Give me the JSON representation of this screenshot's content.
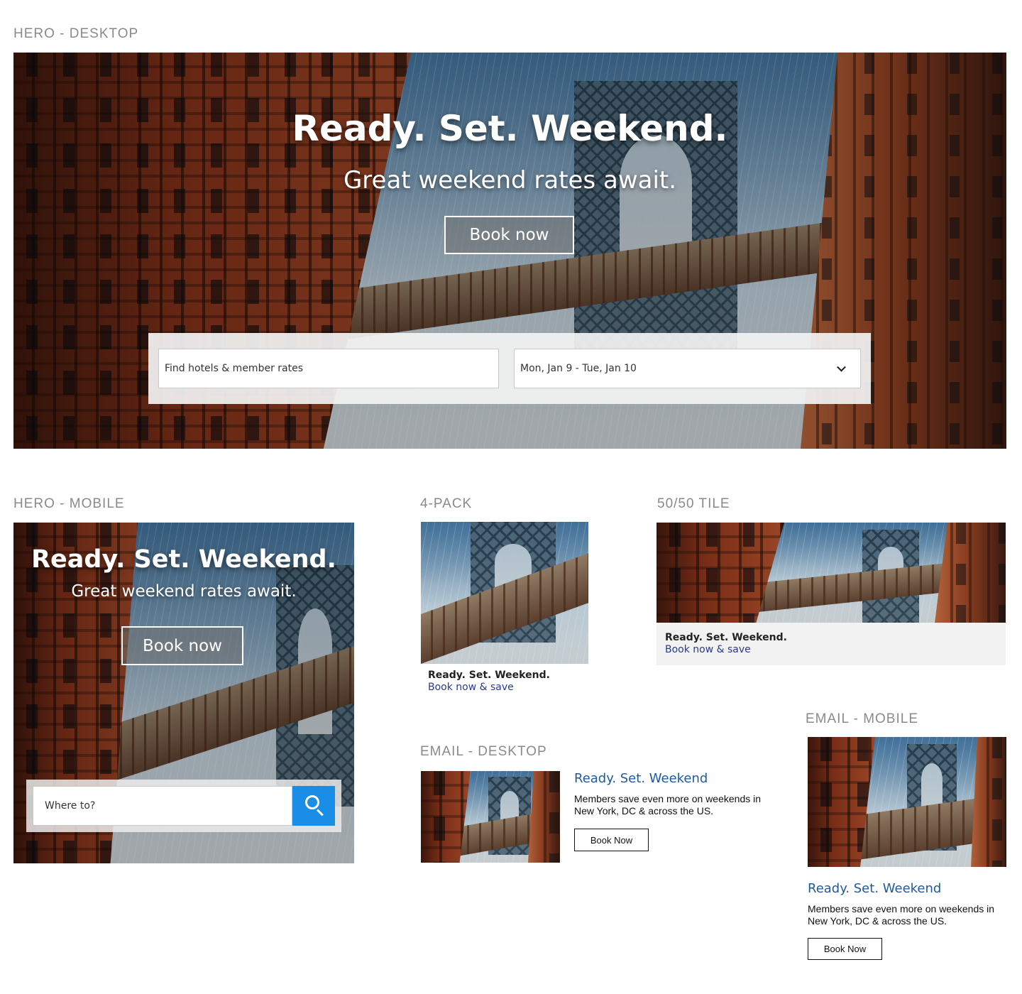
{
  "labels": {
    "hero_desktop": "HERO - DESKTOP",
    "hero_mobile": "HERO - MOBILE",
    "four_pack": "4-PACK",
    "fifty_tile": "50/50 TILE",
    "email_desktop": "EMAIL - DESKTOP",
    "email_mobile": "EMAIL - MOBILE"
  },
  "hero_desktop": {
    "title": "Ready. Set. Weekend.",
    "subtitle": "Great weekend rates await.",
    "cta": "Book now",
    "search_placeholder": "Find hotels & member rates",
    "dates": "Mon, Jan 9 - Tue, Jan 10"
  },
  "hero_mobile": {
    "title": "Ready. Set. Weekend.",
    "subtitle": "Great weekend rates await.",
    "cta": "Book now",
    "search_placeholder": "Where to?"
  },
  "four_pack": {
    "title": "Ready. Set. Weekend.",
    "link": "Book now & save"
  },
  "fifty_tile": {
    "title": "Ready. Set. Weekend.",
    "link": "Book now & save"
  },
  "email_desktop": {
    "title": "Ready. Set. Weekend",
    "copy": "Members save even more on weekends in New York, DC & across the US.",
    "cta": "Book Now"
  },
  "email_mobile": {
    "title": "Ready. Set. Weekend",
    "copy": "Members save even more on weekends in New York, DC & across the US.",
    "cta": "Book Now"
  },
  "colors": {
    "label_gray": "#8a8a8a",
    "link_blue": "#2a3a8c",
    "email_title_blue": "#1f5aa0",
    "search_button_blue": "#1a8ee6"
  },
  "icons": {
    "dropdown": "chevron-down-icon",
    "search": "search-icon"
  }
}
